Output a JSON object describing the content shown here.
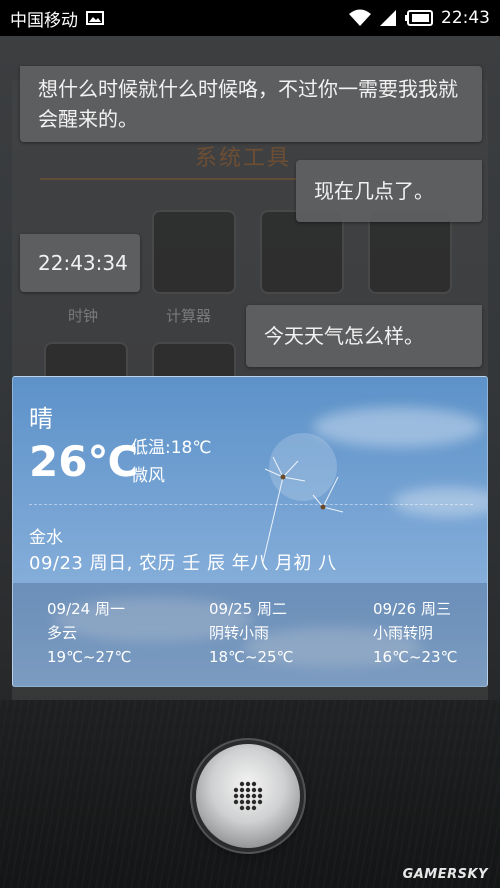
{
  "status_bar": {
    "carrier": "中国移动",
    "time": "22:43",
    "icons": [
      "image-icon",
      "wifi-icon",
      "signal-icon",
      "battery-icon"
    ]
  },
  "background": {
    "folder_title": "系统工具",
    "labels": [
      "时钟",
      "计算器"
    ]
  },
  "conversation": [
    {
      "side": "left",
      "text": "想什么时候就什么时候咯，不过你一需要我我就会醒来的。"
    },
    {
      "side": "right",
      "text": "现在几点了。"
    },
    {
      "side": "left",
      "text": "22:43:34"
    },
    {
      "side": "right",
      "text": "今天天气怎么样。"
    }
  ],
  "weather": {
    "condition": "晴",
    "temperature": "26℃",
    "low": "低温:18℃",
    "wind": "微风",
    "city": "金水",
    "date": "09/23 周日, 农历 壬 辰 年八 月初 八",
    "forecast": [
      {
        "date": "09/24 周一",
        "condition": "多云",
        "range": "19℃~27℃"
      },
      {
        "date": "09/25 周二",
        "condition": "阴转小雨",
        "range": "18℃~25℃"
      },
      {
        "date": "09/26 周三",
        "condition": "小雨转阴",
        "range": "16℃~23℃"
      }
    ]
  },
  "mic_button": {
    "icon": "microphone-grille-icon"
  },
  "watermark": "GAMERSKY",
  "colors": {
    "bubble": "#5f6163",
    "weather_sky": "#77a4d4",
    "status_bar": "#000000"
  }
}
